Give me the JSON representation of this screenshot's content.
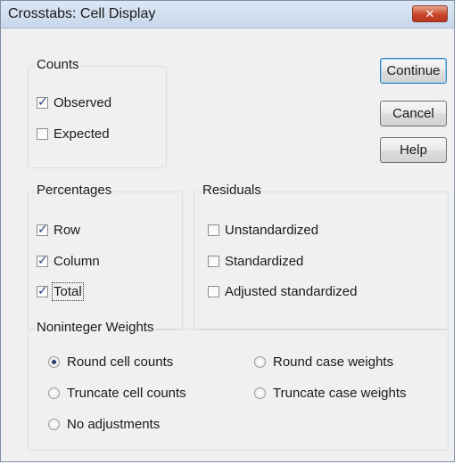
{
  "window": {
    "title": "Crosstabs: Cell Display",
    "close_glyph": "✕"
  },
  "counts": {
    "legend": "Counts",
    "items": [
      {
        "label": "Observed",
        "checked": true
      },
      {
        "label": "Expected",
        "checked": false
      }
    ]
  },
  "buttons": {
    "continue": "Continue",
    "cancel": "Cancel",
    "help": "Help"
  },
  "percentages": {
    "legend": "Percentages",
    "items": [
      {
        "label": "Row",
        "checked": true
      },
      {
        "label": "Column",
        "checked": true
      },
      {
        "label": "Total",
        "checked": true
      }
    ]
  },
  "residuals": {
    "legend": "Residuals",
    "items": [
      {
        "label": "Unstandardized",
        "checked": false
      },
      {
        "label": "Standardized",
        "checked": false
      },
      {
        "label": "Adjusted standardized",
        "checked": false
      }
    ]
  },
  "weights": {
    "legend": "Noninteger Weights",
    "options": [
      {
        "label": "Round cell counts",
        "selected": true
      },
      {
        "label": "Round case weights",
        "selected": false
      },
      {
        "label": "Truncate cell counts",
        "selected": false
      },
      {
        "label": "Truncate case weights",
        "selected": false
      },
      {
        "label": "No adjustments",
        "selected": false
      }
    ]
  }
}
